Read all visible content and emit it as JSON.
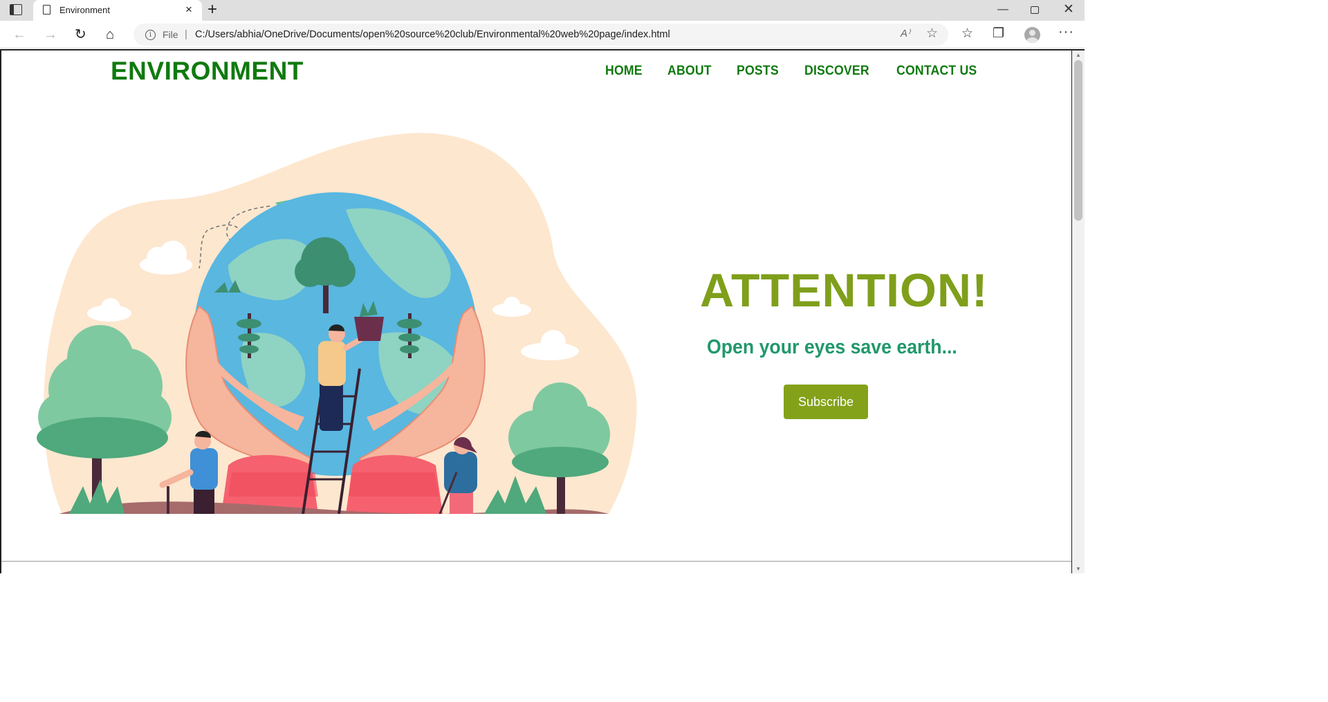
{
  "browser": {
    "tab_title": "Environment",
    "tab_close": "×",
    "new_tab": "+",
    "address_label": "File",
    "address_separator": "|",
    "url": "C:/Users/abhia/OneDrive/Documents/open%20source%20club/Environmental%20web%20page/index.html",
    "window_controls": {
      "minimize": "—",
      "close": "✕"
    },
    "nav": {
      "back": "←",
      "forward": "→",
      "reload": "↻",
      "home": "⌂"
    },
    "toolbar_icons": {
      "read_aloud": "A⁾",
      "add_favorite": "☆",
      "favorites": "☆",
      "collections": "❐",
      "more": "···"
    }
  },
  "site": {
    "logo": "ENVIRONMENT",
    "nav": [
      "HOME",
      "ABOUT",
      "POSTS",
      "DISCOVER",
      "CONTACT US"
    ],
    "hero": {
      "heading": "ATTENTION!",
      "tagline": "Open your eyes save earth...",
      "button": "Subscribe"
    }
  },
  "colors": {
    "brand_green": "#0f7a0f",
    "heading_olive": "#7f9f1b",
    "tagline_teal": "#21986b",
    "button_olive": "#83a21a"
  }
}
